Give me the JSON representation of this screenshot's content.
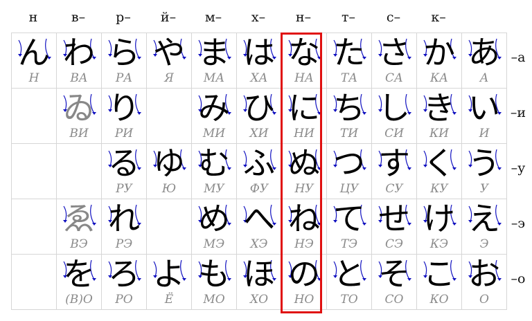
{
  "columns": [
    "н",
    "в–",
    "р–",
    "й–",
    "м–",
    "х–",
    "н–",
    "т–",
    "с–",
    "к–",
    ""
  ],
  "row_suffixes": [
    "–а",
    "–и",
    "–у",
    "–э",
    "–о"
  ],
  "rows": [
    [
      {
        "kana": "ん",
        "roma": "Н"
      },
      {
        "kana": "わ",
        "roma": "ВА"
      },
      {
        "kana": "ら",
        "roma": "РА"
      },
      {
        "kana": "や",
        "roma": "Я"
      },
      {
        "kana": "ま",
        "roma": "МА"
      },
      {
        "kana": "は",
        "roma": "ХА"
      },
      {
        "kana": "な",
        "roma": "НА"
      },
      {
        "kana": "た",
        "roma": "ТА"
      },
      {
        "kana": "さ",
        "roma": "СА"
      },
      {
        "kana": "か",
        "roma": "КА"
      },
      {
        "kana": "あ",
        "roma": "А"
      }
    ],
    [
      {
        "kana": "",
        "roma": ""
      },
      {
        "kana": "ゐ",
        "roma": "ВИ",
        "faded": true
      },
      {
        "kana": "り",
        "roma": "РИ"
      },
      {
        "kana": "",
        "roma": ""
      },
      {
        "kana": "み",
        "roma": "МИ"
      },
      {
        "kana": "ひ",
        "roma": "ХИ"
      },
      {
        "kana": "に",
        "roma": "НИ"
      },
      {
        "kana": "ち",
        "roma": "ТИ"
      },
      {
        "kana": "し",
        "roma": "СИ"
      },
      {
        "kana": "き",
        "roma": "КИ"
      },
      {
        "kana": "い",
        "roma": "И"
      }
    ],
    [
      {
        "kana": "",
        "roma": ""
      },
      {
        "kana": "",
        "roma": ""
      },
      {
        "kana": "る",
        "roma": "РУ"
      },
      {
        "kana": "ゆ",
        "roma": "Ю"
      },
      {
        "kana": "む",
        "roma": "МУ"
      },
      {
        "kana": "ふ",
        "roma": "ФУ"
      },
      {
        "kana": "ぬ",
        "roma": "НУ"
      },
      {
        "kana": "つ",
        "roma": "ЦУ"
      },
      {
        "kana": "す",
        "roma": "СУ"
      },
      {
        "kana": "く",
        "roma": "КУ"
      },
      {
        "kana": "う",
        "roma": "У"
      }
    ],
    [
      {
        "kana": "",
        "roma": ""
      },
      {
        "kana": "ゑ",
        "roma": "ВЭ",
        "faded": true
      },
      {
        "kana": "れ",
        "roma": "РЭ"
      },
      {
        "kana": "",
        "roma": ""
      },
      {
        "kana": "め",
        "roma": "МЭ"
      },
      {
        "kana": "へ",
        "roma": "ХЭ"
      },
      {
        "kana": "ね",
        "roma": "НЭ"
      },
      {
        "kana": "て",
        "roma": "ТЭ"
      },
      {
        "kana": "せ",
        "roma": "СЭ"
      },
      {
        "kana": "け",
        "roma": "КЭ"
      },
      {
        "kana": "え",
        "roma": "Э"
      }
    ],
    [
      {
        "kana": "",
        "roma": ""
      },
      {
        "kana": "を",
        "roma": "(В)О"
      },
      {
        "kana": "ろ",
        "roma": "РО"
      },
      {
        "kana": "よ",
        "roma": "Ё"
      },
      {
        "kana": "も",
        "roma": "МО"
      },
      {
        "kana": "ほ",
        "roma": "ХО"
      },
      {
        "kana": "の",
        "roma": "НО"
      },
      {
        "kana": "と",
        "roma": "ТО"
      },
      {
        "kana": "そ",
        "roma": "СО"
      },
      {
        "kana": "こ",
        "roma": "КО"
      },
      {
        "kana": "お",
        "roma": "О"
      }
    ]
  ],
  "highlight_column": 6,
  "colors": {
    "highlight": "#e01010",
    "stroke_arrow": "#1010c0",
    "romanization": "#8a8a8a",
    "faded_kana": "#888888",
    "grid": "#d6d6d6"
  }
}
